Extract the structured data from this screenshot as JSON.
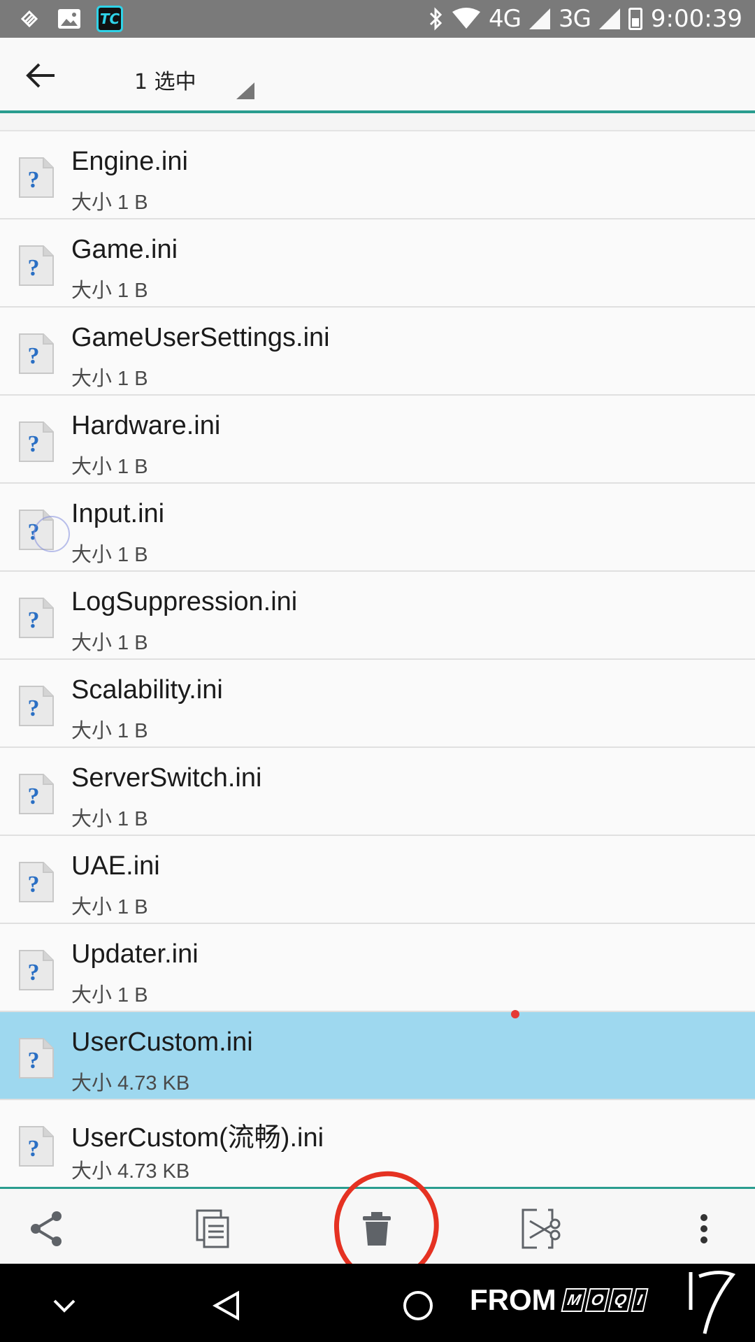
{
  "status_bar": {
    "network_1": "4G",
    "network_2": "3G",
    "time": "9:00:39",
    "icons": [
      "notification-icon",
      "image-icon",
      "tc-app-icon",
      "bluetooth-icon",
      "wifi-icon",
      "signal-icon",
      "battery-icon"
    ],
    "tc_label": "TC"
  },
  "app_bar": {
    "selection_label": "1 选中"
  },
  "files": [
    {
      "name": "Engine.ini",
      "size": "大小 1 B"
    },
    {
      "name": "Game.ini",
      "size": "大小 1 B"
    },
    {
      "name": "GameUserSettings.ini",
      "size": "大小 1 B"
    },
    {
      "name": "Hardware.ini",
      "size": "大小 1 B"
    },
    {
      "name": "Input.ini",
      "size": "大小 1 B"
    },
    {
      "name": "LogSuppression.ini",
      "size": "大小 1 B"
    },
    {
      "name": "Scalability.ini",
      "size": "大小 1 B"
    },
    {
      "name": "ServerSwitch.ini",
      "size": "大小 1 B"
    },
    {
      "name": "UAE.ini",
      "size": "大小 1 B"
    },
    {
      "name": "Updater.ini",
      "size": "大小 1 B"
    },
    {
      "name": "UserCustom.ini",
      "size": "大小 4.73 KB",
      "selected": true
    },
    {
      "name": "UserCustom(流畅).ini",
      "size": "大小 4.73 KB"
    }
  ],
  "actions": [
    "share-icon",
    "copy-icon",
    "delete-icon",
    "cut-icon",
    "more-icon"
  ],
  "colors": {
    "accent": "#2a9d8f",
    "selected_row": "#9ed8ef",
    "annotation": "#e53222"
  },
  "watermark": {
    "prefix": "FROM",
    "logo": [
      "M",
      "O",
      "Q",
      "I"
    ]
  }
}
